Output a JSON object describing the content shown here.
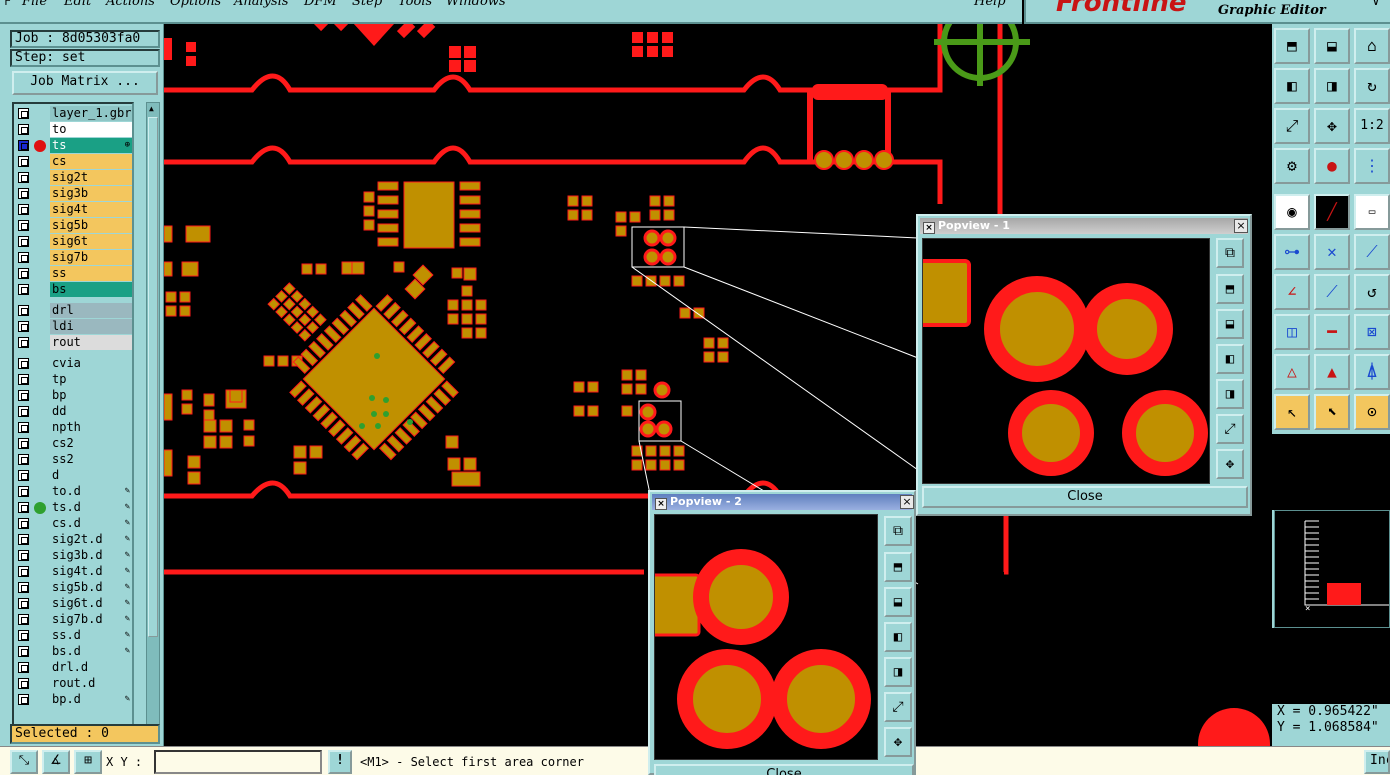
{
  "menu": [
    "File",
    "Edit",
    "Actions",
    "Options",
    "Analysis",
    "DFM",
    "Step",
    "Tools",
    "Windows",
    "Help"
  ],
  "brand": {
    "logo": "Frontline",
    "product": "Graphic Editor"
  },
  "job": {
    "label": "Job : 8d05303fa0",
    "step": "Step: set",
    "matrix_button": "Job Matrix ..."
  },
  "layers": [
    {
      "name": "layer_1.gbr",
      "color": "#8fc6c6"
    },
    {
      "name": "to",
      "color": "#ffffff"
    },
    {
      "name": "ts",
      "color": "#1aa085",
      "active": true,
      "dot": "#e01010"
    },
    {
      "name": "cs",
      "color": "#f3c65e"
    },
    {
      "name": "sig2t",
      "color": "#f3c65e"
    },
    {
      "name": "sig3b",
      "color": "#f3c65e"
    },
    {
      "name": "sig4t",
      "color": "#f3c65e"
    },
    {
      "name": "sig5b",
      "color": "#f3c65e"
    },
    {
      "name": "sig6t",
      "color": "#f3c65e"
    },
    {
      "name": "sig7b",
      "color": "#f3c65e"
    },
    {
      "name": "ss",
      "color": "#f3c65e"
    },
    {
      "name": "bs",
      "color": "#1aa085"
    },
    {
      "name": "drl",
      "color": "#9ab8bf",
      "gap": true
    },
    {
      "name": "ldi",
      "color": "#9ab8bf"
    },
    {
      "name": "rout",
      "color": "#dcdcdc"
    },
    {
      "name": "cvia",
      "color": "#9ed6d6",
      "gap": true
    },
    {
      "name": "tp",
      "color": "#9ed6d6"
    },
    {
      "name": "bp",
      "color": "#9ed6d6"
    },
    {
      "name": "dd",
      "color": "#9ed6d6"
    },
    {
      "name": "npth",
      "color": "#9ed6d6"
    },
    {
      "name": "cs2",
      "color": "#9ed6d6"
    },
    {
      "name": "ss2",
      "color": "#9ed6d6"
    },
    {
      "name": "d",
      "color": "#9ed6d6"
    },
    {
      "name": "to.d",
      "color": "#9ed6d6",
      "pen": true
    },
    {
      "name": "ts.d",
      "color": "#9ed6d6",
      "pen": true,
      "dot": "#2fa02f"
    },
    {
      "name": "cs.d",
      "color": "#9ed6d6",
      "pen": true
    },
    {
      "name": "sig2t.d",
      "color": "#9ed6d6",
      "pen": true
    },
    {
      "name": "sig3b.d",
      "color": "#9ed6d6",
      "pen": true
    },
    {
      "name": "sig4t.d",
      "color": "#9ed6d6",
      "pen": true
    },
    {
      "name": "sig5b.d",
      "color": "#9ed6d6",
      "pen": true
    },
    {
      "name": "sig6t.d",
      "color": "#9ed6d6",
      "pen": true
    },
    {
      "name": "sig7b.d",
      "color": "#9ed6d6",
      "pen": true
    },
    {
      "name": "ss.d",
      "color": "#9ed6d6",
      "pen": true
    },
    {
      "name": "bs.d",
      "color": "#9ed6d6",
      "pen": true
    },
    {
      "name": "drl.d",
      "color": "#9ed6d6"
    },
    {
      "name": "rout.d",
      "color": "#9ed6d6"
    },
    {
      "name": "bp.d",
      "color": "#9ed6d6",
      "pen": true
    }
  ],
  "selected": "Selected : 0",
  "status": {
    "xy_label": "X Y :",
    "xy_value": "",
    "message": "<M1> - Select first area corner",
    "right_btn": "Inc"
  },
  "coords": {
    "x": "X = 0.965422\"",
    "y": "Y = 1.068584\""
  },
  "popview1": {
    "title": "Popview - 1",
    "close": "Close"
  },
  "popview2": {
    "title": "Popview - 2",
    "close": "Close"
  },
  "colors": {
    "trace": "#ff1a1a",
    "pad": "#c09000",
    "panel": "#9ed6d6",
    "fiducial": "#4a9a18"
  }
}
